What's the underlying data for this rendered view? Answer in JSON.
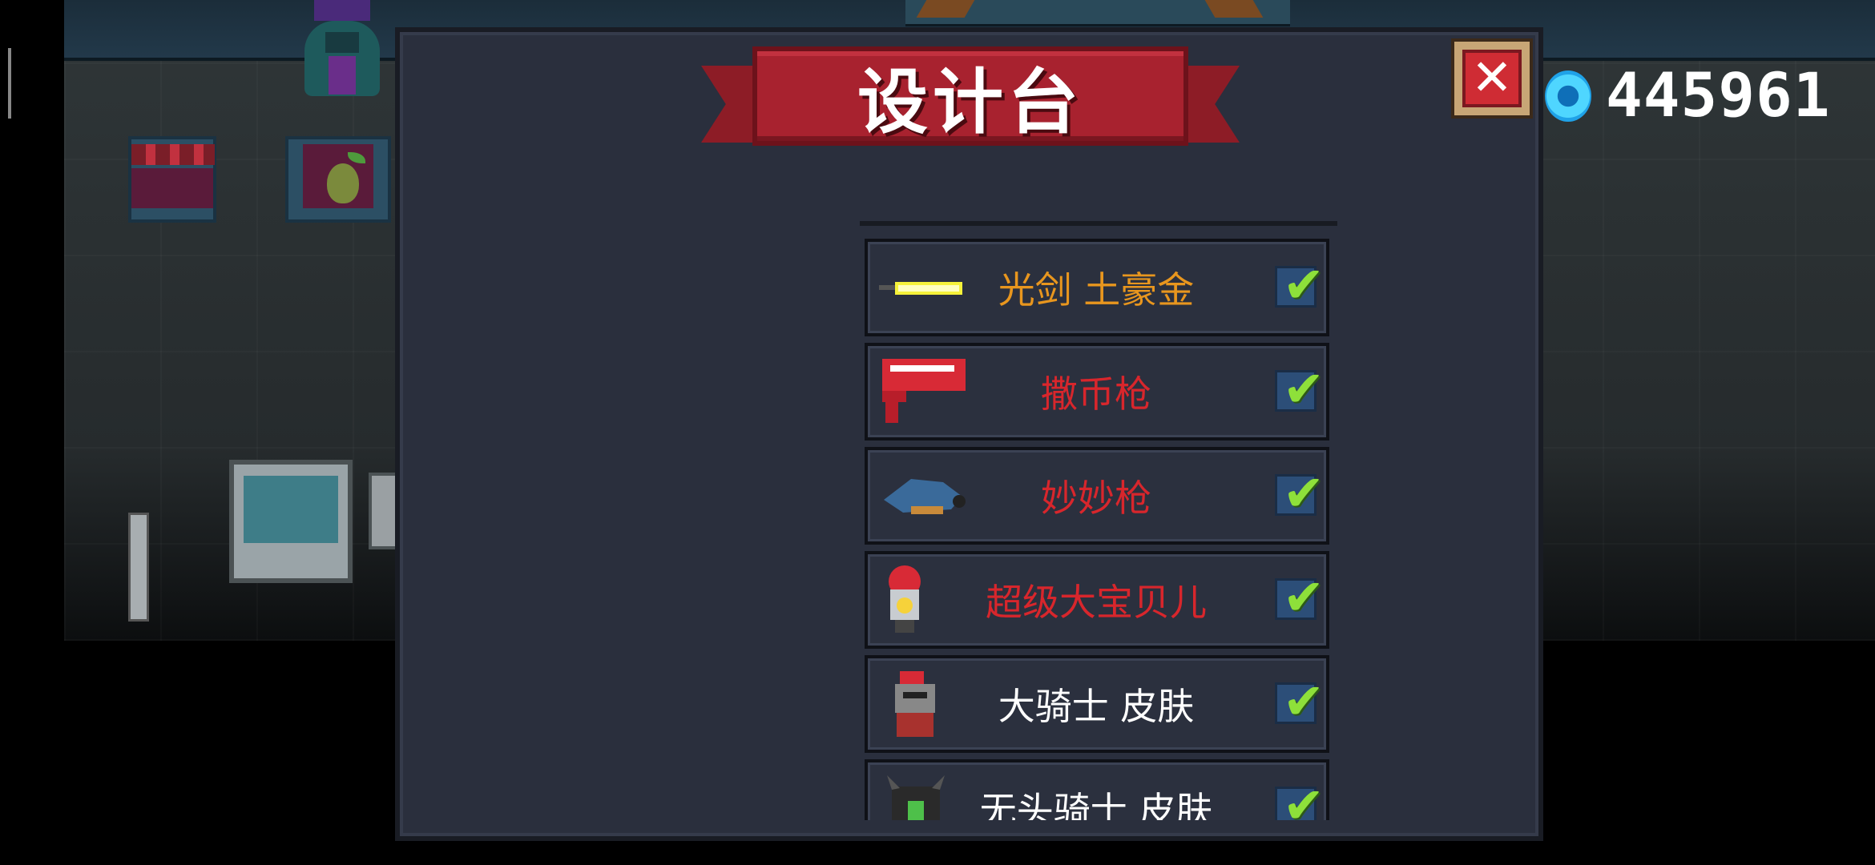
{
  "dialog": {
    "title": "设计台",
    "close_label": "✕"
  },
  "currency": {
    "icon": "gem-icon",
    "amount": "445961"
  },
  "items": [
    {
      "label": "光剑 土豪金",
      "color": "#e8961e",
      "icon": "lightsaber-icon",
      "checked": true
    },
    {
      "label": "撒币枪",
      "color": "#d8262c",
      "icon": "coin-gun-icon",
      "checked": true
    },
    {
      "label": "妙妙枪",
      "color": "#d8262c",
      "icon": "magic-gun-icon",
      "checked": true
    },
    {
      "label": "超级大宝贝儿",
      "color": "#d8262c",
      "icon": "nuke-bomb-icon",
      "checked": true
    },
    {
      "label": "大骑士 皮肤",
      "color": "#ffffff",
      "icon": "knight-skin-icon",
      "checked": true
    },
    {
      "label": "无头骑士 皮肤",
      "color": "#ffffff",
      "icon": "headless-knight-skin-icon",
      "checked": true
    }
  ],
  "check_glyph": "✔"
}
